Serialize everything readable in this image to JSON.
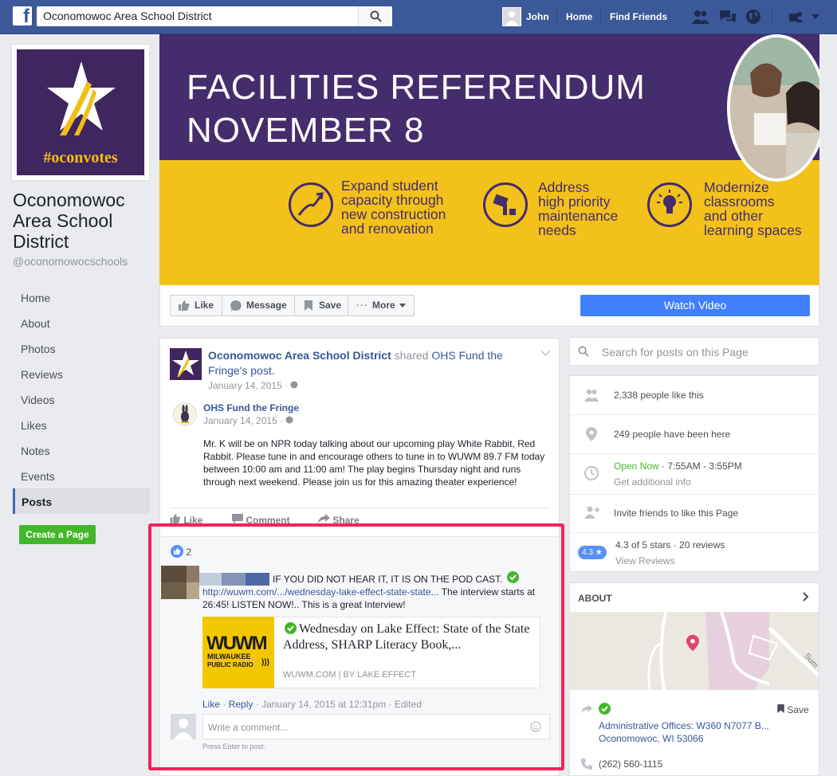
{
  "topbar": {
    "search_value": "Oconomowoc Area School District",
    "user_name": "John",
    "home": "Home",
    "find_friends": "Find Friends"
  },
  "left": {
    "hashtag": "#oconvotes",
    "page_name": "Oconomowoc Area School District",
    "handle": "@oconomowocschools",
    "nav": [
      "Home",
      "About",
      "Photos",
      "Reviews",
      "Videos",
      "Likes",
      "Notes",
      "Events",
      "Posts"
    ],
    "create_page": "Create a Page"
  },
  "cover": {
    "title_line1": "FACILITIES REFERENDUM",
    "title_line2": "NOVEMBER 8",
    "item1": [
      "Expand student",
      "capacity through",
      "new construction",
      "and renovation"
    ],
    "item2": [
      "Address",
      "high priority",
      "maintenance",
      "needs"
    ],
    "item3": [
      "Modernize",
      "classrooms",
      "and other",
      "learning spaces"
    ]
  },
  "actions": {
    "like": "Like",
    "message": "Message",
    "save": "Save",
    "more": "More",
    "watch": "Watch Video"
  },
  "post": {
    "author": "Oconomowoc Area School District",
    "shared_text": "shared",
    "shared_link_a": "OHS Fund the",
    "shared_link_b": "Fringe",
    "shared_suffix": "'s post.",
    "date": "January 14, 2015 ·",
    "inner_author": "OHS Fund the Fringe",
    "inner_date": "January 14, 2015 ·",
    "body": "Mr. K will be on NPR today talking about our upcoming play White Rabbit, Red Rabbit. Please tune in and encourage others to tune in to WUWM 89.7 FM today between 10:00 am and 11:00 am! The play begins Thursday night and runs through next weekend. Please join us for this amazing theater experience!",
    "like": "Like",
    "comment": "Comment",
    "share": "Share",
    "reactions": "2"
  },
  "comment": {
    "text": "IF YOU DID NOT HEAR IT, IT IS ON THE POD CAST.",
    "link": "http://wuwm.com/.../wednesday-lake-effect-state-state...",
    "text2_a": "The interview starts at",
    "text2_b": "26:45! LISTEN NOW!.. This is a great Interview!",
    "preview_title": "Wednesday on Lake Effect: State of the State Address, SHARP Literacy Book,...",
    "preview_source": "WUWM.COM | BY LAKE EFFECT",
    "logo_main": "WUWM",
    "logo_sub1": "MILWAUKEE",
    "logo_sub2": "PUBLIC RADIO",
    "action_like": "Like",
    "action_reply": "Reply",
    "action_meta": "· January 14, 2015 at 12:31pm · Edited",
    "write_placeholder": "Write a comment...",
    "press_enter": "Press Enter to post."
  },
  "right": {
    "search_placeholder": "Search for posts on this Page",
    "likes": "2,338 people like this",
    "been_here": "249 people have been here",
    "open_now": "Open Now",
    "hours": "· 7:55AM - 3:55PM",
    "additional": "Get additional info",
    "invite": "Invite friends to like this Page",
    "rating_badge": "4.3 ★",
    "rating": "4.3 of 5 stars · 20 reviews",
    "view_reviews": "View Reviews",
    "about": "ABOUT",
    "map_street": "Sum",
    "address1": "Administrative Offices: W360 N7077 B...",
    "address2": "Oconomowoc, WI 53066",
    "save": "Save",
    "phone": "(262) 560-1115"
  },
  "colors": {
    "fb_blue": "#3b5998",
    "purple": "#452c6d",
    "yellow": "#f2c11a",
    "highlight": "#f0245a",
    "green": "#42b72a"
  }
}
